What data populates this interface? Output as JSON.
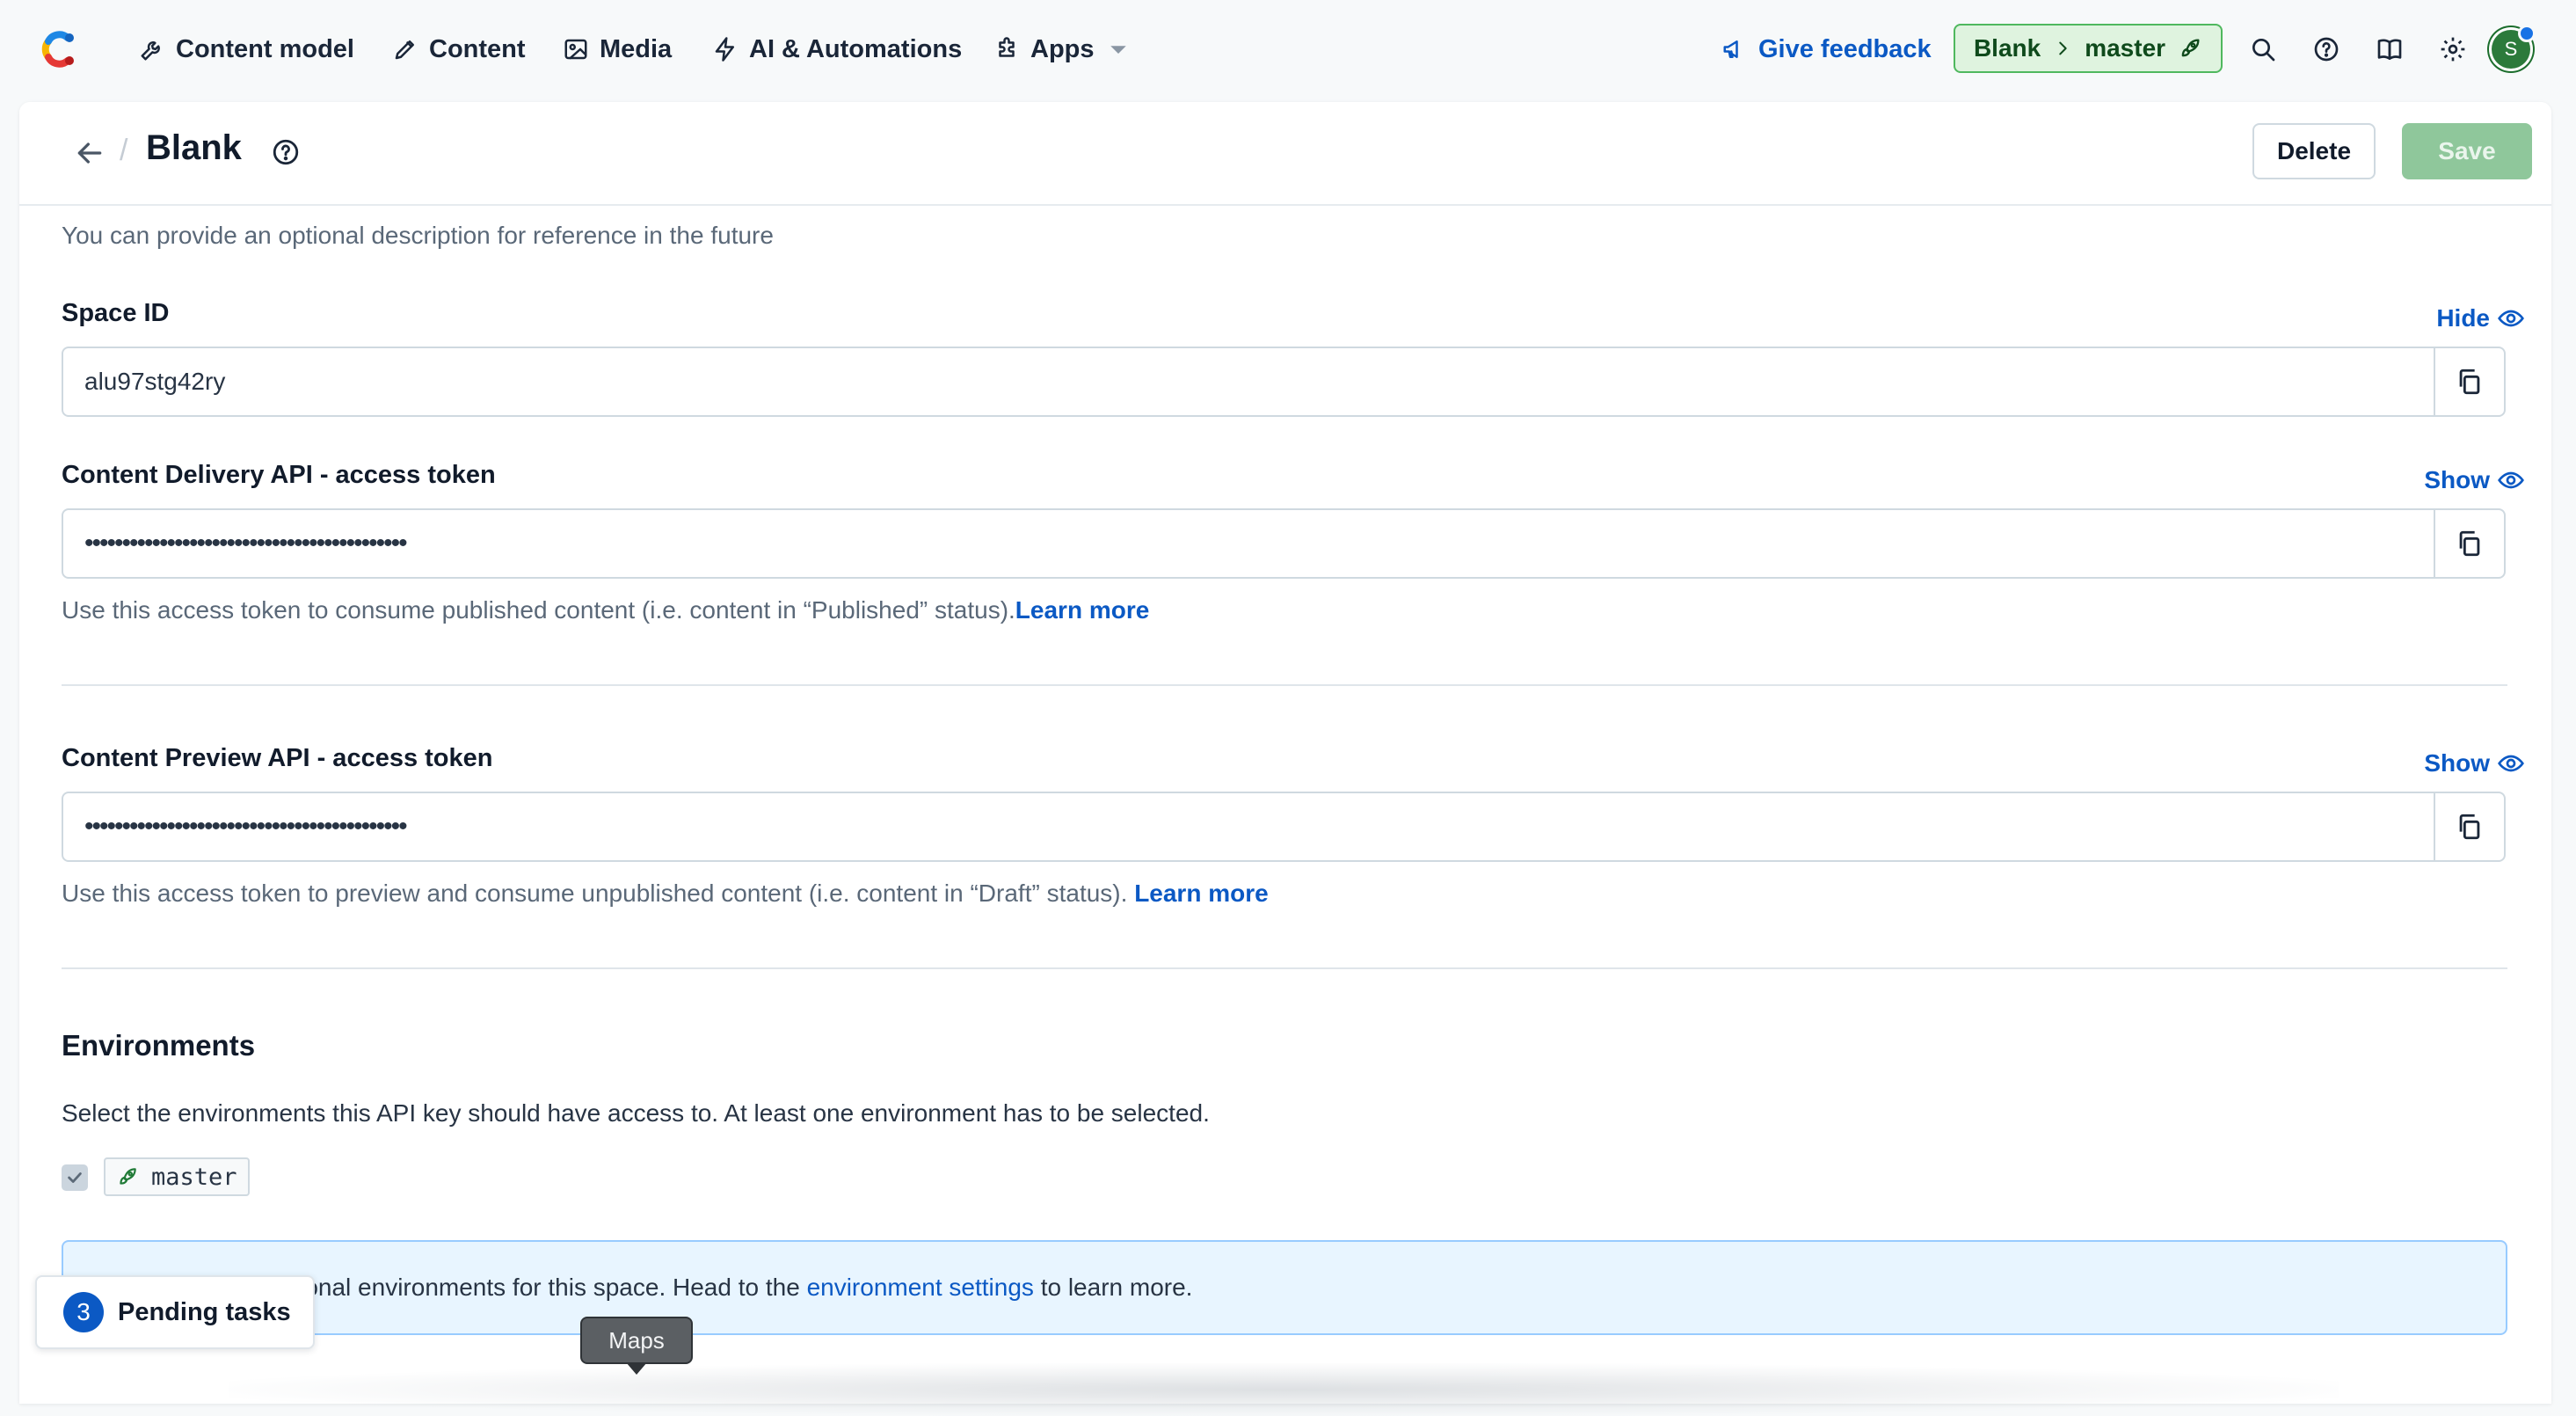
{
  "nav": {
    "items": [
      {
        "label": "Content model",
        "icon": "wrench-icon"
      },
      {
        "label": "Content",
        "icon": "pen-icon"
      },
      {
        "label": "Media",
        "icon": "image-icon"
      },
      {
        "label": "AI & Automations",
        "icon": "lightning-icon"
      },
      {
        "label": "Apps",
        "icon": "puzzle-icon"
      }
    ],
    "feedback": "Give feedback",
    "space": "Blank",
    "environment": "master",
    "avatar_initial": "S"
  },
  "header": {
    "title": "Blank",
    "delete_label": "Delete",
    "save_label": "Save"
  },
  "form": {
    "description_help": "You can provide an optional description for reference in the future",
    "space_id": {
      "label": "Space ID",
      "toggle": "Hide",
      "value": "alu97stg42ry"
    },
    "delivery_token": {
      "label": "Content Delivery API - access token",
      "toggle": "Show",
      "value": "•••••••••••••••••••••••••••••••••••••••••••",
      "help": "Use this access token to consume published content (i.e. content in “Published” status).",
      "link": "Learn more"
    },
    "preview_token": {
      "label": "Content Preview API - access token",
      "toggle": "Show",
      "value": "•••••••••••••••••••••••••••••••••••••••••••",
      "help": "Use this access token to preview and consume unpublished content (i.e. content in “Draft” status).",
      "link": "Learn more"
    }
  },
  "environments": {
    "title": "Environments",
    "description": "Select the environments this API key should have access to. At least one environment has to be selected.",
    "items": [
      {
        "name": "master",
        "checked": true
      }
    ],
    "note_prefix": "t up any additional environments for this space. Head to the ",
    "note_link": "environment settings",
    "note_suffix": " to learn more."
  },
  "pending": {
    "count": "3",
    "label": "Pending tasks"
  },
  "tooltip": "Maps",
  "colors": {
    "accent": "#0b59c4",
    "env_badge_bg": "#dff3df",
    "env_badge_border": "#4fb85e",
    "save_disabled": "#8fc79b",
    "note_bg": "#e8f5ff"
  }
}
